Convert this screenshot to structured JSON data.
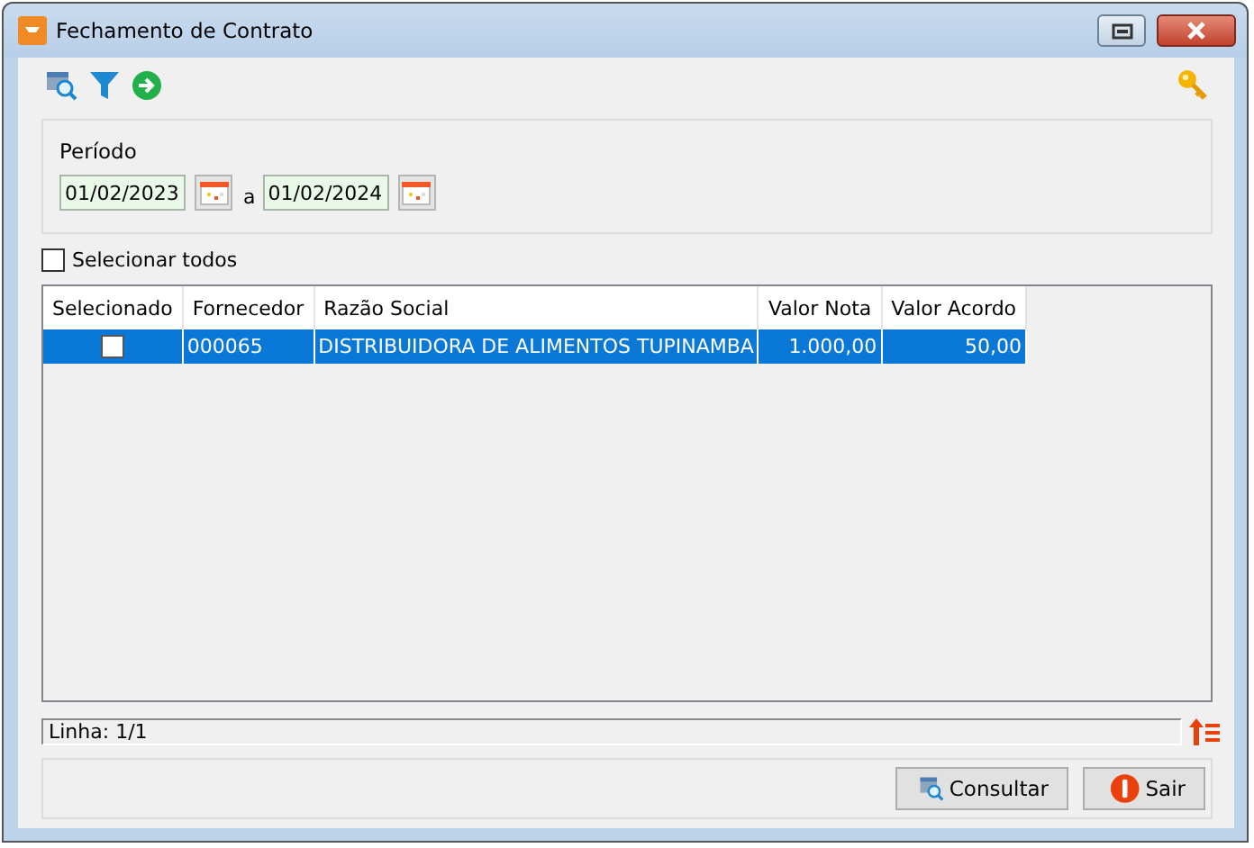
{
  "window": {
    "title": "Fechamento de Contrato"
  },
  "period": {
    "label": "Período",
    "from": "01/02/2023",
    "separator": "a",
    "to": "01/02/2024"
  },
  "select_all": {
    "label": "Selecionar todos",
    "checked": false
  },
  "table": {
    "columns": [
      "Selecionado",
      "Fornecedor",
      "Razão Social",
      "Valor Nota",
      "Valor Acordo"
    ],
    "rows": [
      {
        "selected": true,
        "checked": false,
        "fornecedor": "000065",
        "razao_social": "DISTRIBUIDORA DE ALIMENTOS TUPINAMBA",
        "valor_nota": "1.000,00",
        "valor_acordo": "50,00"
      }
    ]
  },
  "status_bar": "Linha: 1/1",
  "buttons": [
    {
      "kind": "search",
      "label": "Consultar"
    },
    {
      "kind": "exit",
      "label": "Sair"
    }
  ]
}
